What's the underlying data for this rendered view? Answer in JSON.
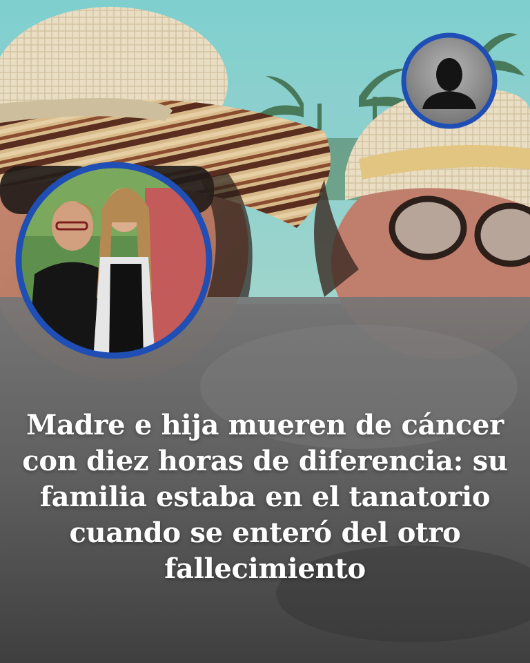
{
  "headline": "Madre e hija mueren de cáncer con diez horas de diferencia: su familia estaba en el tanatorio cuando se enteró del otro fallecimiento",
  "colors": {
    "circle_border": "#1f4fb5",
    "sky": "#6fc1c3",
    "lower_overlay": "#5c5c5c",
    "headline_text": "#ffffff"
  },
  "icons": {
    "avatar": "anonymous-person-silhouette-icon"
  }
}
